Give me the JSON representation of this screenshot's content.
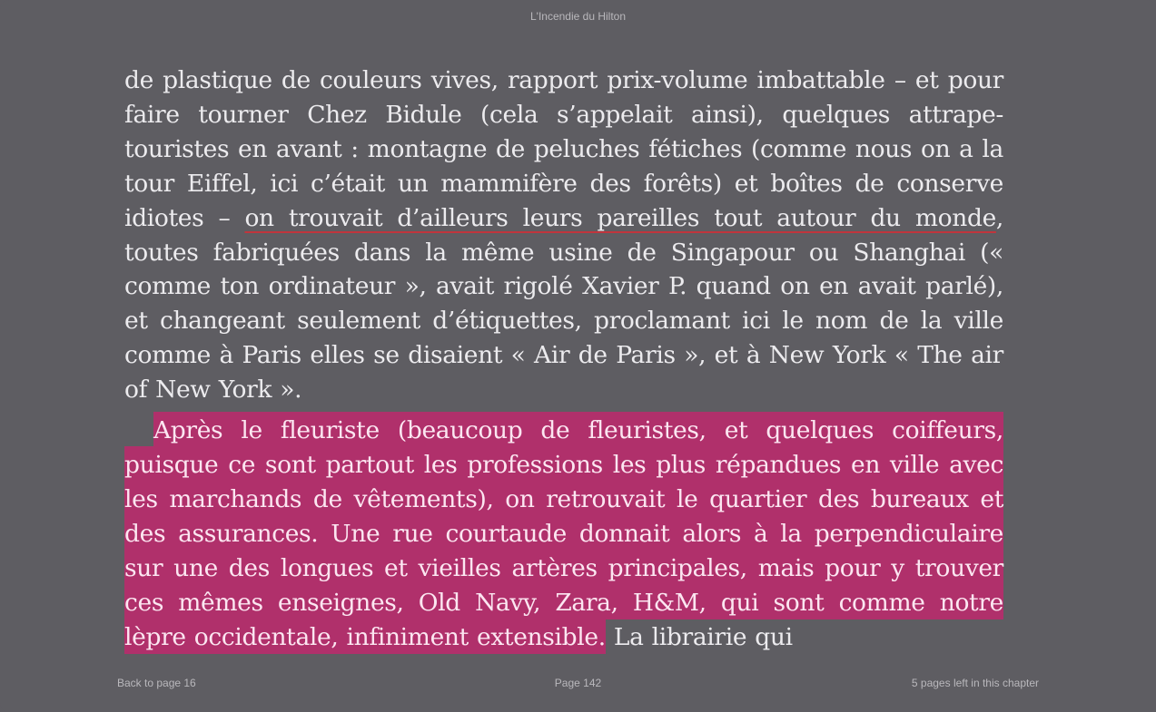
{
  "window": {
    "title": "L'Incendie du Hilton"
  },
  "content": {
    "p1_before_underline": "de plastique de couleurs vives, rapport prix-volume imbattable – et pour faire tourner Chez Bidule (cela s’appelait ainsi), quelques attrape-touristes en avant : montagne de peluches fétiches (comme nous on a la tour Eiffel, ici c’était un mammifère des forêts) et boîtes de conserve idiotes – ",
    "p1_underlined": "on trouvait d’ailleurs leurs pareilles tout autour du monde",
    "p1_after_underline": ", toutes fabriquées dans la même usine de Singapour ou Shanghai (« comme ton ordinateur », avait rigolé Xavier P. quand on en avait parlé), et changeant seulement d’étiquettes, proclamant ici le nom de la ville comme à Paris elles se disaient « Air de Paris », et à New York « The air of New York ».",
    "p2_highlighted": "Après le fleuriste (beaucoup de fleuristes, et quelques coiffeurs, puisque ce sont partout les professions les plus répandues en ville avec les marchands de vêtements), on retrouvait le quartier des bureaux et des assurances. Une rue courtaude donnait alors à la per­pendiculaire sur une des longues et vieilles artères principales, mais pour y trouver ces mêmes enseignes, Old Navy, Zara, H&M, qui sont comme notre lèpre occidentale, infiniment extensible.",
    "p2_after": " La librairie qui"
  },
  "footer": {
    "back_link": "Back to page 16",
    "page_number": "Page 142",
    "pages_left": "5 pages left in this chapter"
  },
  "colors": {
    "background": "#5e5d62",
    "text": "#ecebee",
    "highlight": "#b0306b",
    "underline": "#c0353d",
    "chrome_text": "#b9b8bc"
  }
}
